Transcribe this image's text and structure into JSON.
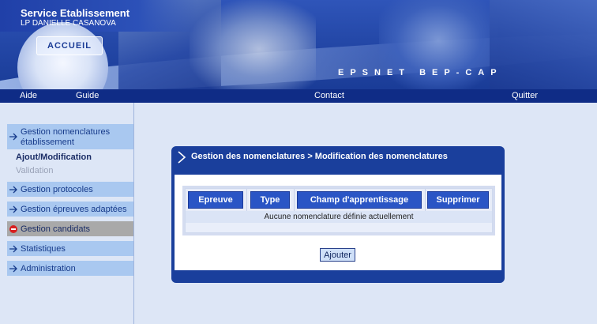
{
  "header": {
    "title": "Service Etablissement",
    "subtitle": "LP DANIELLE CASANOVA",
    "home_button": "ACCUEIL",
    "tagline": "EPSNET BEP-CAP"
  },
  "topnav": {
    "aide": "Aide",
    "guide": "Guide",
    "contact": "Contact",
    "quitter": "Quitter"
  },
  "sidebar": {
    "items": [
      {
        "label_line1": "Gestion nomenclatures",
        "label_line2": "établissement"
      },
      {
        "label": "Ajout/Modification"
      },
      {
        "label": "Validation"
      },
      {
        "label": "Gestion protocoles"
      },
      {
        "label": "Gestion épreuves adaptées"
      },
      {
        "label": "Gestion candidats"
      },
      {
        "label": "Statistiques"
      },
      {
        "label": "Administration"
      }
    ]
  },
  "panel": {
    "title": "Gestion des nomenclatures > Modification des nomenclatures",
    "columns": [
      "Epreuve",
      "Type",
      "Champ d'apprentissage",
      "Supprimer"
    ],
    "empty_message": "Aucune nomenclature définie actuellement",
    "add_button": "Ajouter"
  },
  "colors": {
    "banner": "#2448a8",
    "nav_bar": "#0f2c86",
    "sidebar_highlight": "#a9c8f0",
    "disabled_item": "#a9a9a9",
    "panel": "#1a3f9c",
    "column_button": "#2a55c5"
  }
}
